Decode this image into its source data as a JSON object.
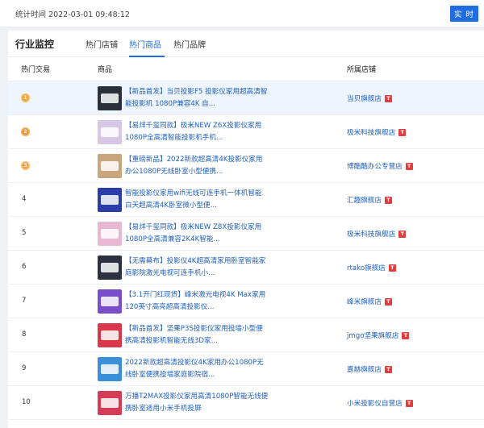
{
  "header": {
    "stats_time": "统计时间 2022-03-01 09:48:12",
    "realtime_button": "实 时"
  },
  "section": {
    "title": "行业监控",
    "tabs": [
      {
        "label": "热门店铺",
        "active": false
      },
      {
        "label": "热门商品",
        "active": true
      },
      {
        "label": "热门品牌",
        "active": false
      }
    ]
  },
  "table": {
    "columns": [
      "热门交易",
      "商品",
      "所属店铺"
    ],
    "badge_text": "T",
    "rows": [
      {
        "rank": "1",
        "medal": "gold",
        "name": "【新品首发】当贝投影F5 投影仪家用超高清智能投影机 1080P兼容4K 自...",
        "store": "当贝旗舰店",
        "thumb_color": "#2a2f3a"
      },
      {
        "rank": "2",
        "medal": "silver",
        "name": "【易烊千玺同款】极米NEW Z6X投影仪家用1080P全高清智能投影机手机...",
        "store": "极米科技旗舰店",
        "thumb_color": "#d9c7e8"
      },
      {
        "rank": "3",
        "medal": "bronze",
        "name": "【重磅新品】2022新款超高清4K投影仪家用办公1080P无线卧室小型便携...",
        "store": "博酷酷办公专营店",
        "thumb_color": "#c8a57a"
      },
      {
        "rank": "4",
        "medal": "",
        "name": "智能投影仪家用wifi无线可连手机一体机智能白天超高清4K卧室微小型便...",
        "store": "汇趣旗舰店",
        "thumb_color": "#2c3ea8"
      },
      {
        "rank": "5",
        "medal": "",
        "name": "【易烊千玺同款】极米NEW Z8X投影仪家用1080P全高清兼容2K4K智能...",
        "store": "极米科技旗舰店",
        "thumb_color": "#e8b7d2"
      },
      {
        "rank": "6",
        "medal": "",
        "name": "【无需幕布】投影仪4K超高清家用卧室智能家庭影院激光电视可连手机小...",
        "store": "rtako旗舰店",
        "thumb_color": "#2b3140"
      },
      {
        "rank": "7",
        "medal": "",
        "name": "【3.1开门红现货】峰米激光电视4K Max家用120英寸高亮超高清投影仪...",
        "store": "峰米旗舰店",
        "thumb_color": "#7b4ec9"
      },
      {
        "rank": "8",
        "medal": "",
        "name": "【新品首发】坚果P3S投影仪家用投墙小型便携高清投影机智能无线3D家...",
        "store": "jmgo坚果旗舰店",
        "thumb_color": "#d9384a"
      },
      {
        "rank": "9",
        "medal": "",
        "name": "2022新款超高清投影仪4K家用办公1080P无线卧室便携投墙家庭影院宿...",
        "store": "嘉赫旗舰店",
        "thumb_color": "#3b8fd9"
      },
      {
        "rank": "10",
        "medal": "",
        "name": "万播T2MAX投影仪家用高清1080P智能无线便携卧室适用小米手机投屏",
        "store": "小米投影仪自营店",
        "thumb_color": "#d43c56"
      }
    ]
  }
}
